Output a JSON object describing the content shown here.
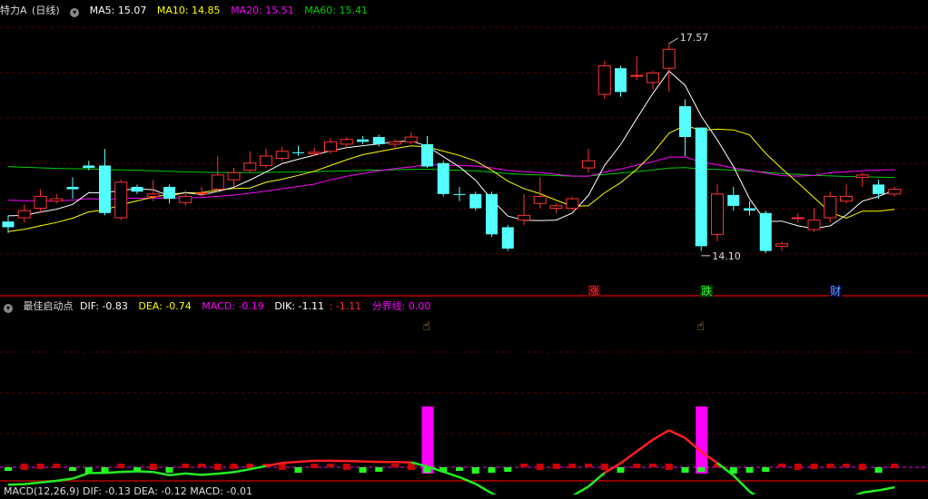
{
  "top_header": {
    "symbol": "特力A",
    "period": "(日线)",
    "ma5": "MA5: 15.07",
    "ma10": "MA10: 14.85",
    "ma20": "MA20: 15.51",
    "ma60": "MA60: 15.41"
  },
  "mid_header": {
    "name": "最佳启动点",
    "dif": "DIF: -0.83",
    "dea": "DEA: -0.74",
    "macd": "MACD: -0.19",
    "dik": "DIK: -1.11",
    "dik2": ": -1.11",
    "fenjie": "分界线: 0.00"
  },
  "bottom_header": {
    "text": "MACD(12,26,9)  DIF: -0.13  DEA: -0.12  MACD: -0.01"
  },
  "annotations": {
    "high": "17.57",
    "low": "14.10"
  },
  "markers": {
    "zhang": "涨",
    "die": "跌",
    "cai": "财"
  },
  "colors": {
    "up": "#ff3232",
    "down": "#54ffff",
    "ma5": "#ffffff",
    "ma10": "#ffff00",
    "ma20": "#ff00ff",
    "ma60": "#00cc00",
    "signal": "#ff00ff"
  },
  "chart_data": {
    "type": "candlestick",
    "candles": [
      [
        13.82,
        13.7,
        13.95,
        13.58
      ],
      [
        13.9,
        14.05,
        14.18,
        13.8
      ],
      [
        14.1,
        14.35,
        14.5,
        14.0
      ],
      [
        14.25,
        14.3,
        14.4,
        14.2
      ],
      [
        14.55,
        14.5,
        14.75,
        14.3
      ],
      [
        15.0,
        14.95,
        15.1,
        14.9
      ],
      [
        15.0,
        14.0,
        15.35,
        13.95
      ],
      [
        13.9,
        14.65,
        14.7,
        13.85
      ],
      [
        14.55,
        14.45,
        14.6,
        14.4
      ],
      [
        14.35,
        14.4,
        14.7,
        14.25
      ],
      [
        14.55,
        14.3,
        14.6,
        14.2
      ],
      [
        14.22,
        14.35,
        14.48,
        14.15
      ],
      [
        14.4,
        14.42,
        14.55,
        14.35
      ],
      [
        14.5,
        14.8,
        15.2,
        14.45
      ],
      [
        14.7,
        14.85,
        14.95,
        14.55
      ],
      [
        14.9,
        15.05,
        15.3,
        14.85
      ],
      [
        15.0,
        15.2,
        15.35,
        14.95
      ],
      [
        15.15,
        15.3,
        15.4,
        15.1
      ],
      [
        15.28,
        15.26,
        15.42,
        15.2
      ],
      [
        15.25,
        15.28,
        15.38,
        15.2
      ],
      [
        15.3,
        15.5,
        15.58,
        15.25
      ],
      [
        15.45,
        15.55,
        15.6,
        15.4
      ],
      [
        15.55,
        15.5,
        15.62,
        15.45
      ],
      [
        15.6,
        15.45,
        15.65,
        15.4
      ],
      [
        15.45,
        15.5,
        15.55,
        15.35
      ],
      [
        15.5,
        15.6,
        15.7,
        15.45
      ],
      [
        15.45,
        14.98,
        15.62,
        14.95
      ],
      [
        15.05,
        14.4,
        15.1,
        14.35
      ],
      [
        14.4,
        14.38,
        14.55,
        14.25
      ],
      [
        14.4,
        14.1,
        14.45,
        14.05
      ],
      [
        14.4,
        13.55,
        14.45,
        13.5
      ],
      [
        13.7,
        13.25,
        13.75,
        13.2
      ],
      [
        13.85,
        13.95,
        14.4,
        13.75
      ],
      [
        14.2,
        14.35,
        14.75,
        14.1
      ],
      [
        14.1,
        14.15,
        14.2,
        14.0
      ],
      [
        14.1,
        14.3,
        14.35,
        14.05
      ],
      [
        14.95,
        15.1,
        15.35,
        14.85
      ],
      [
        16.5,
        17.1,
        17.2,
        16.4
      ],
      [
        17.05,
        16.55,
        17.1,
        16.45
      ],
      [
        16.9,
        16.9,
        17.3,
        16.8
      ],
      [
        16.75,
        16.95,
        17.0,
        16.6
      ],
      [
        17.05,
        17.45,
        17.57,
        16.55
      ],
      [
        16.25,
        15.6,
        16.4,
        15.2
      ],
      [
        15.8,
        13.3,
        15.8,
        13.2
      ],
      [
        13.55,
        14.4,
        14.6,
        13.4
      ],
      [
        14.38,
        14.15,
        14.55,
        14.05
      ],
      [
        14.1,
        14.05,
        14.25,
        13.95
      ],
      [
        14.0,
        13.2,
        14.05,
        13.15
      ],
      [
        13.3,
        13.35,
        13.4,
        13.2
      ],
      [
        13.9,
        13.9,
        14.0,
        13.8
      ],
      [
        13.65,
        13.85,
        14.1,
        13.6
      ],
      [
        13.9,
        14.35,
        14.45,
        13.8
      ],
      [
        14.25,
        14.35,
        14.6,
        14.2
      ],
      [
        14.75,
        14.8,
        14.85,
        14.55
      ],
      [
        14.6,
        14.4,
        14.7,
        14.3
      ],
      [
        14.4,
        14.5,
        14.55,
        14.35
      ]
    ],
    "signal_bars": [
      26,
      43
    ],
    "high_label_index": 41,
    "low_label_index": 43
  }
}
